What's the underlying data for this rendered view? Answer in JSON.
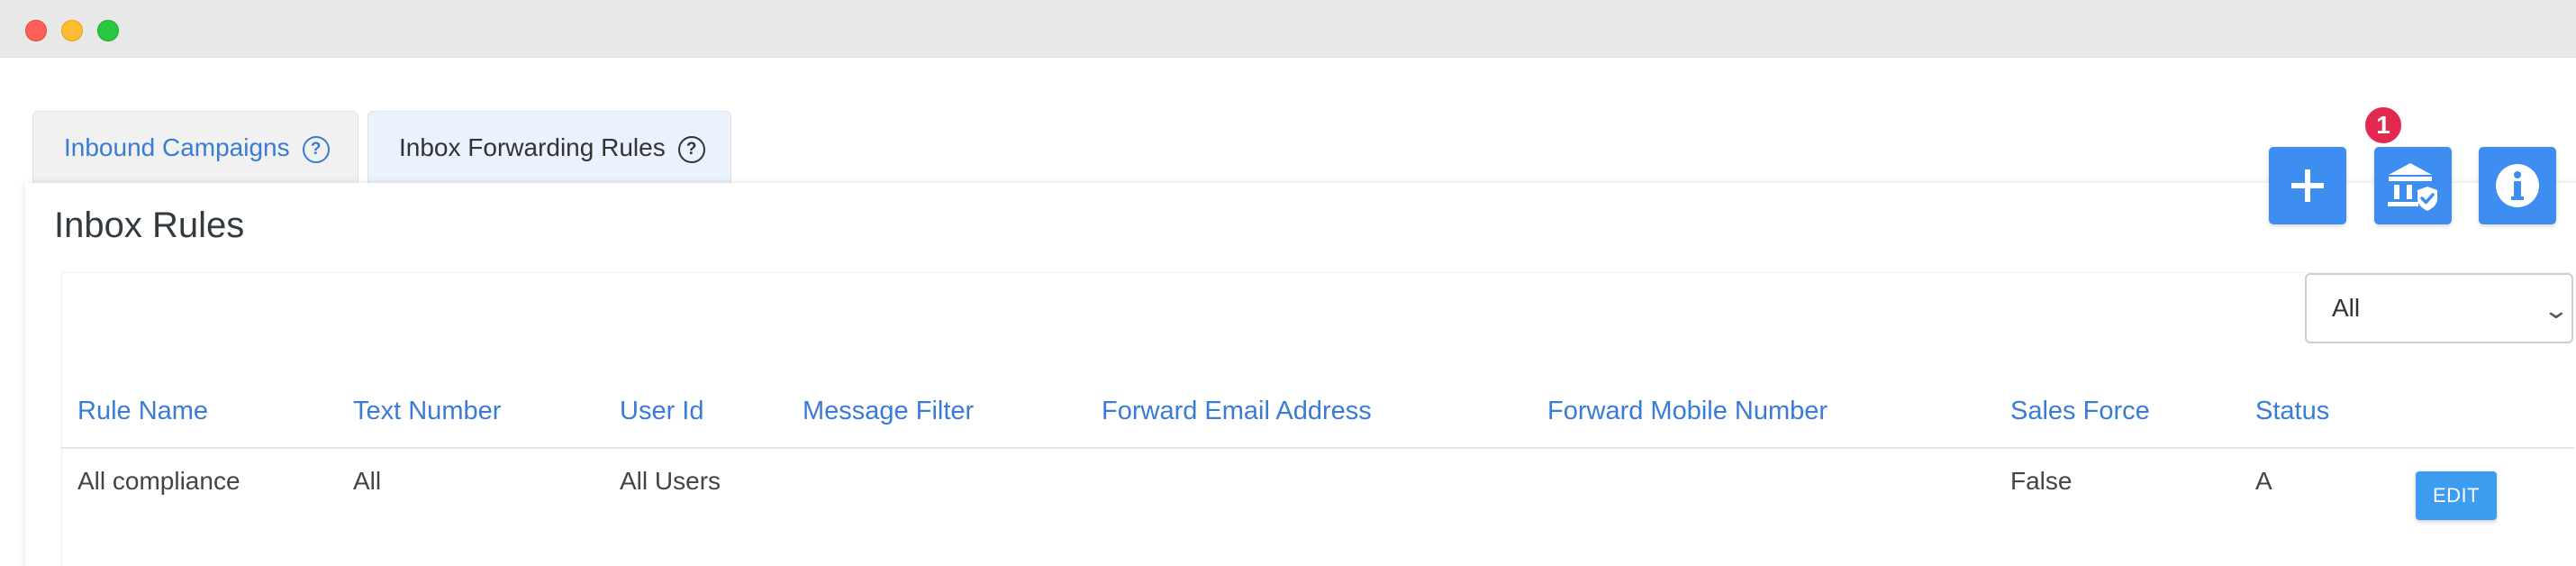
{
  "tabs": [
    {
      "label": "Inbound Campaigns"
    },
    {
      "label": "Inbox Forwarding Rules"
    }
  ],
  "page": {
    "title": "Inbox Rules"
  },
  "actions": {
    "add": {
      "icon": "plus-icon"
    },
    "compliance": {
      "icon": "bank-shield-icon",
      "badge": "1"
    },
    "info": {
      "icon": "info-icon"
    }
  },
  "filter": {
    "selected": "All"
  },
  "table": {
    "columns": [
      "Rule Name",
      "Text Number",
      "User Id",
      "Message Filter",
      "Forward Email Address",
      "Forward Mobile Number",
      "Sales Force",
      "Status"
    ],
    "rows": [
      {
        "rule_name": "All compliance",
        "text_number": "All",
        "user_id": "All Users",
        "message_filter": "",
        "forward_email": "",
        "forward_mobile": "",
        "sales_force": "False",
        "status": "A",
        "action": "EDIT"
      }
    ]
  },
  "colors": {
    "accent": "#3d8ef0",
    "link": "#3a7bd5",
    "badge": "#e2294f",
    "active_tab": "#eaf2fd"
  }
}
